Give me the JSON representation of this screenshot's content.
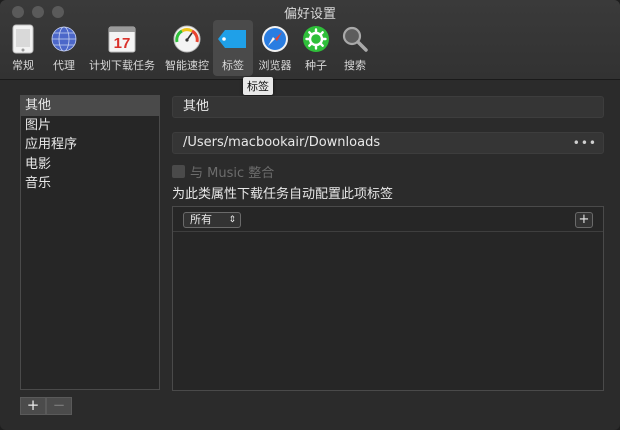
{
  "window": {
    "title": "偏好设置"
  },
  "toolbar": {
    "items": [
      {
        "label": "常规",
        "icon": "phone-icon"
      },
      {
        "label": "代理",
        "icon": "globe-icon"
      },
      {
        "label": "计划下载任务",
        "icon": "calendar-icon",
        "calendar_day": "17"
      },
      {
        "label": "智能速控",
        "icon": "speedometer-icon"
      },
      {
        "label": "标签",
        "icon": "tag-icon"
      },
      {
        "label": "浏览器",
        "icon": "compass-icon"
      },
      {
        "label": "种子",
        "icon": "gear-icon"
      },
      {
        "label": "搜索",
        "icon": "magnifier-icon"
      }
    ],
    "selected": "标签",
    "tooltip": "标签"
  },
  "sidebar": {
    "items": [
      {
        "label": "其他"
      },
      {
        "label": "图片"
      },
      {
        "label": "应用程序"
      },
      {
        "label": "电影"
      },
      {
        "label": "音乐"
      }
    ],
    "add_label": "+",
    "remove_label": "−"
  },
  "detail": {
    "name_value": "其他",
    "path_value": "/Users/macbookair/Downloads",
    "more_label": "•••",
    "music_checkbox_label": "与 Music 整合",
    "description": "为此类属性下载任务自动配置此项标签",
    "filter_select": "所有",
    "filter_add_label": "+"
  },
  "colors": {
    "tag_blue": "#1fa0e8",
    "compass_blue": "#2a7de1",
    "seed_green": "#2fbf3a",
    "calendar_red": "#d9312b"
  }
}
